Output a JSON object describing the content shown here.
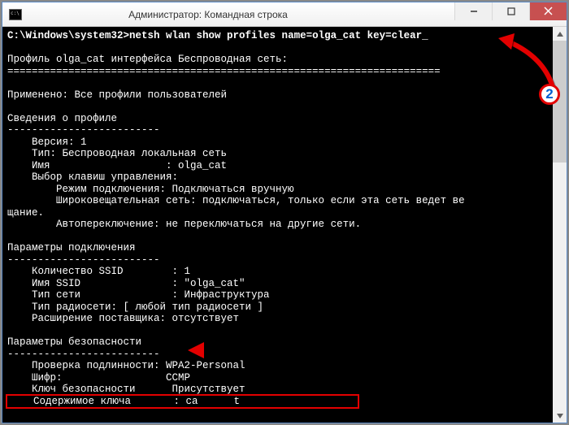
{
  "window": {
    "title": "Администратор: Командная строка"
  },
  "term": {
    "prompt": "C:\\Windows\\system32>",
    "command": "netsh wlan show profiles name=olga_cat key=clear",
    "blank": "",
    "profile_header": "Профиль olga_cat интерфейса Беспроводная сеть:",
    "hr": "=======================================================================",
    "applied": "Применено: Все профили пользователей",
    "sec_info": "Сведения о профиле",
    "dash": "-------------------------",
    "version": "    Версия: 1",
    "type": "    Тип: Беспроводная локальная сеть",
    "name": "    Имя                   : olga_cat",
    "keymgmt": "    Выбор клавиш управления:",
    "connmode": "        Режим подключения: Подключаться вручную",
    "broadcast": "        Широковещательная сеть: подключаться, только если эта сеть ведет ве",
    "broadcast2": "щание.",
    "autoswitch": "        Автопереключение: не переключаться на другие сети.",
    "sec_conn": "Параметры подключения",
    "ssid_count": "    Количество SSID        : 1",
    "ssid_name": "    Имя SSID               : \"olga_cat\"",
    "nettype": "    Тип сети               : Инфраструктура",
    "radiotype": "    Тип радиосети: [ любой тип радиосети ]",
    "vendor": "    Расширение поставщика: отсутствует",
    "sec_sec": "Параметры безопасности",
    "auth": "    Проверка подлинности: WPA2-Personal",
    "cipher": "    Шифр:                 CCMP",
    "seckey": "    Ключ безопасности      Присутствует",
    "keycontent_label": "    Содержимое ключа       : ca",
    "keycontent_tail": "t"
  },
  "annotations": {
    "badge2": "2"
  }
}
